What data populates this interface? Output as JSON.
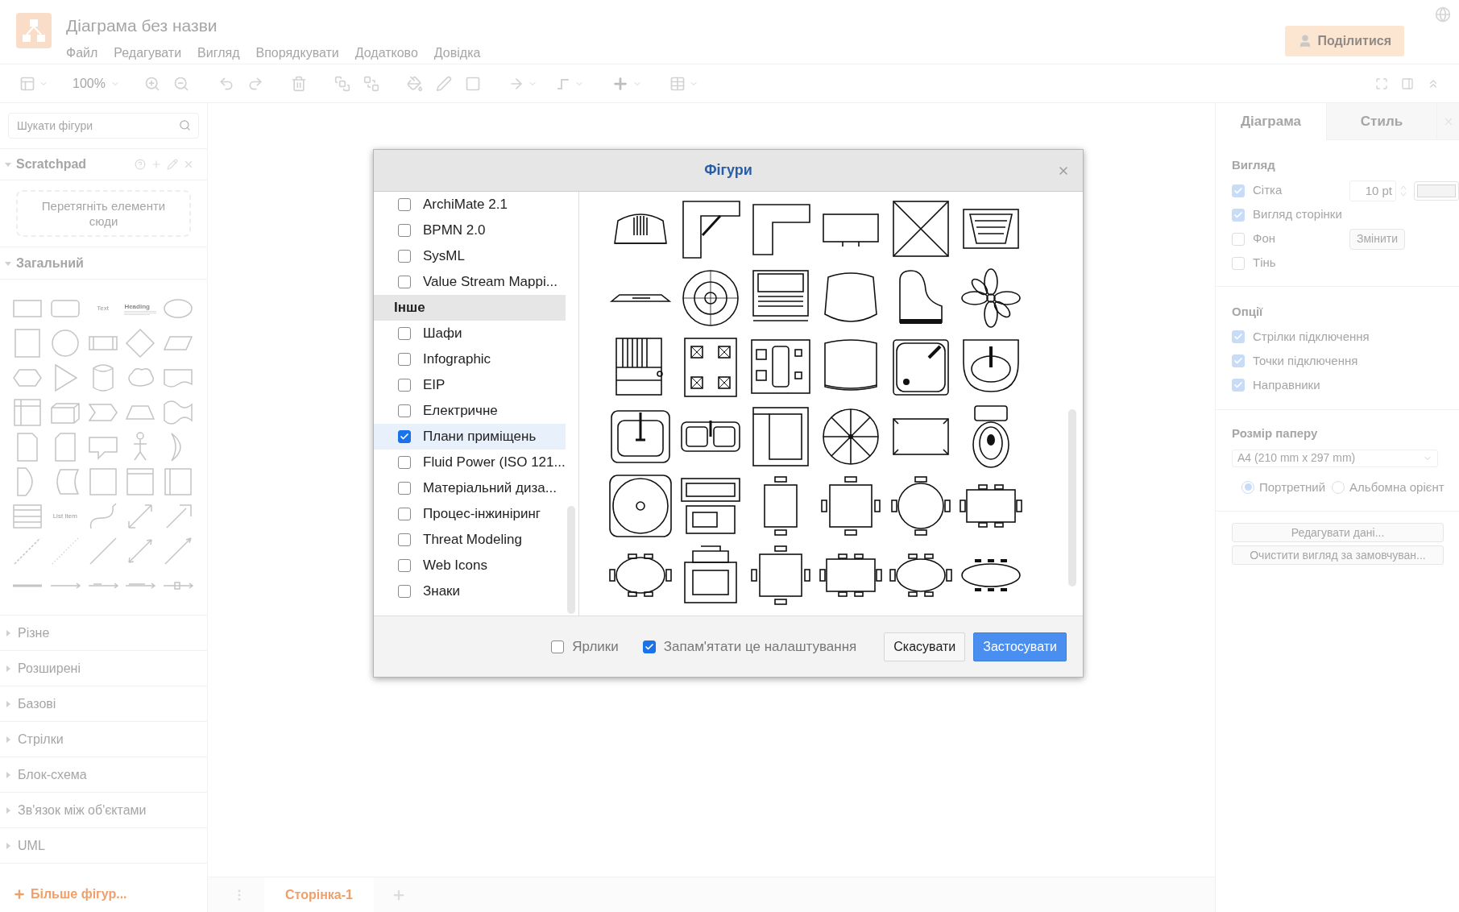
{
  "app": {
    "title": "Діаграма без назви",
    "menu": [
      "Файл",
      "Редагувати",
      "Вигляд",
      "Впорядкувати",
      "Додатково",
      "Довідка"
    ],
    "share_button": "Поділитися"
  },
  "toolbar": {
    "zoom": "100%"
  },
  "sidebar": {
    "search_placeholder": "Шукати фігури",
    "scratchpad": {
      "title": "Scratchpad",
      "expanded": true,
      "drop_hint": "Перетягніть елементи сюди"
    },
    "general": {
      "title": "Загальний",
      "expanded": true,
      "text_label": "Text",
      "heading_label": "Heading",
      "list_item_label": "List Item"
    },
    "sections": [
      {
        "title": "Різне",
        "expanded": false
      },
      {
        "title": "Розширені",
        "expanded": false
      },
      {
        "title": "Базові",
        "expanded": false
      },
      {
        "title": "Стрілки",
        "expanded": false
      },
      {
        "title": "Блок-схема",
        "expanded": false
      },
      {
        "title": "Зв'язок між об'єктами",
        "expanded": false
      },
      {
        "title": "UML",
        "expanded": false
      }
    ],
    "more_shapes": "Більше фігур..."
  },
  "format_panel": {
    "tabs": [
      {
        "label": "Діаграма",
        "selected": true
      },
      {
        "label": "Стиль",
        "selected": false
      }
    ],
    "view_title": "Вигляд",
    "view_options": [
      {
        "label": "Сітка",
        "checked": true
      },
      {
        "label": "Вигляд сторінки",
        "checked": true
      },
      {
        "label": "Фон",
        "checked": false
      },
      {
        "label": "Тінь",
        "checked": false
      }
    ],
    "grid_size": "10 pt",
    "change_button": "Змінити",
    "options_title": "Опції",
    "options": [
      {
        "label": "Стрілки підключення",
        "checked": true
      },
      {
        "label": "Точки підключення",
        "checked": true
      },
      {
        "label": "Направники",
        "checked": true
      }
    ],
    "paper_title": "Розмір паперу",
    "paper_size": "A4 (210 mm x 297 mm)",
    "orientations": [
      {
        "label": "Портретний",
        "selected": true
      },
      {
        "label": "Альбомна орієнт",
        "selected": false
      }
    ],
    "buttons": [
      "Редагувати дані...",
      "Очистити вигляд за замовчуван..."
    ]
  },
  "page_tabs": [
    {
      "label": "Сторінка-1",
      "selected": true
    }
  ],
  "dialog": {
    "title": "Фігури",
    "libraries": [
      {
        "kind": "item",
        "label": "ArchiMate 2.1",
        "checked": false,
        "selected": false
      },
      {
        "kind": "item",
        "label": "BPMN 2.0",
        "checked": false,
        "selected": false
      },
      {
        "kind": "item",
        "label": "SysML",
        "checked": false,
        "selected": false
      },
      {
        "kind": "item",
        "label": "Value Stream Mappi...",
        "checked": false,
        "selected": false
      },
      {
        "kind": "header",
        "label": "Інше"
      },
      {
        "kind": "item",
        "label": "Шафи",
        "checked": false,
        "selected": false
      },
      {
        "kind": "item",
        "label": "Infographic",
        "checked": false,
        "selected": false
      },
      {
        "kind": "item",
        "label": "EIP",
        "checked": false,
        "selected": false
      },
      {
        "kind": "item",
        "label": "Електричне",
        "checked": false,
        "selected": false
      },
      {
        "kind": "item",
        "label": "Плани приміщень",
        "checked": true,
        "selected": true
      },
      {
        "kind": "item",
        "label": "Fluid Power (ISO 121...",
        "checked": false,
        "selected": false
      },
      {
        "kind": "item",
        "label": "Матеріальний диза...",
        "checked": false,
        "selected": false
      },
      {
        "kind": "item",
        "label": "Процес-інжиніринг",
        "checked": false,
        "selected": false
      },
      {
        "kind": "item",
        "label": "Threat Modeling",
        "checked": false,
        "selected": false
      },
      {
        "kind": "item",
        "label": "Web Icons",
        "checked": false,
        "selected": false
      },
      {
        "kind": "item",
        "label": "Знаки",
        "checked": false,
        "selected": false
      }
    ],
    "footer_options": [
      {
        "label": "Ярлики",
        "checked": false
      },
      {
        "label": "Запам'ятати це налаштування",
        "checked": true
      }
    ],
    "buttons": [
      {
        "label": "Скасувати",
        "kind": "secondary"
      },
      {
        "label": "Застосувати",
        "kind": "primary"
      }
    ]
  }
}
